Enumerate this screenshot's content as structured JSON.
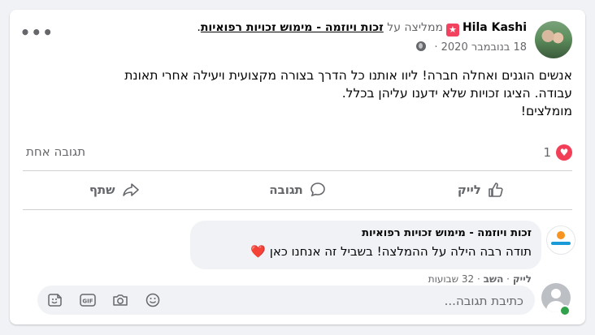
{
  "post": {
    "author": "Hila Kashi",
    "recommends_text": "ממליצה על",
    "page_name": "זכות ויוזמה - מימוש זכויות רפואיות",
    "page_punct": ".",
    "date": "18 בנובמבר 2020",
    "more": "•••",
    "text_lines": [
      "אנשים הוגנים ואחלה חברה! ליוו אותנו כל הדרך בצורה מקצועית ויעילה אחרי תאונת",
      "עבודה. הציגו זכויות שלא ידענו עליהן בכלל.",
      "מומלצים!"
    ],
    "reaction_count": "1",
    "comment_count": "תגובה אחת"
  },
  "actions": {
    "like": "לייק",
    "comment": "תגובה",
    "share": "שתף"
  },
  "reply": {
    "author": "זכות ויוזמה - מימוש זכויות רפואיות",
    "text": "תודה רבה הילה על ההמלצה! בשביל זה אנחנו כאן",
    "heart": "❤️",
    "like": "לייק",
    "dot": "·",
    "reply": "השב",
    "time": "32 שבועות"
  },
  "composer": {
    "placeholder": "כתיבת תגובה..."
  },
  "icons": {
    "recommend": "recommend-star-icon",
    "globe": "globe-icon",
    "heart": "heart-reaction-icon",
    "like": "thumbs-up-icon",
    "comment": "comment-bubble-icon",
    "share": "share-arrow-icon",
    "emoji": "emoji-icon",
    "camera": "camera-icon",
    "gif": "gif-icon",
    "sticker": "sticker-icon"
  },
  "colors": {
    "heart": "#f33e58",
    "recommend": "#f3425f",
    "online": "#31a24c"
  }
}
